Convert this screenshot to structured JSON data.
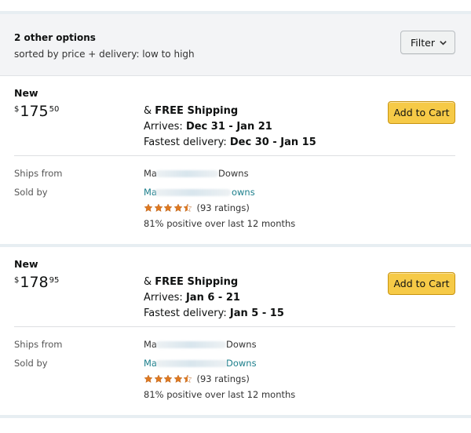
{
  "header": {
    "count_label": "2 other options",
    "sort_label": "sorted by price + delivery: low to high",
    "filter_label": "Filter"
  },
  "offers": [
    {
      "condition": "New",
      "price_symbol": "$",
      "price_whole": "175",
      "price_fraction": "50",
      "shipping_prefix": "& ",
      "shipping": "FREE Shipping",
      "arrives_label": "Arrives: ",
      "arrives": "Dec 31 - Jan 21",
      "fastest_label": "Fastest delivery: ",
      "fastest": "Dec 30 - Jan 15",
      "add_to_cart": "Add to Cart",
      "ships_from_label": "Ships from",
      "ships_from_visible_start": "Ma",
      "ships_from_visible_end": "Downs",
      "sold_by_label": "Sold by",
      "sold_by_visible_start": "Ma",
      "sold_by_visible_end": "owns",
      "rating_count": "(93 ratings)",
      "rating_value": 4.5,
      "positive": "81% positive over last 12 months"
    },
    {
      "condition": "New",
      "price_symbol": "$",
      "price_whole": "178",
      "price_fraction": "95",
      "shipping_prefix": "& ",
      "shipping": "FREE Shipping",
      "arrives_label": "Arrives: ",
      "arrives": "Jan 6 - 21",
      "fastest_label": "Fastest delivery: ",
      "fastest": "Jan 5 - 15",
      "add_to_cart": "Add to Cart",
      "ships_from_label": "Ships from",
      "ships_from_visible_start": "Ma",
      "ships_from_visible_end": "Downs",
      "sold_by_label": "Sold by",
      "sold_by_visible_start": "Ma",
      "sold_by_visible_end": "Downs",
      "rating_count": "(93 ratings)",
      "rating_value": 4.5,
      "positive": "81% positive over last 12 months"
    }
  ],
  "colors": {
    "button_yellow": "#f6ca47",
    "link_teal": "#1b7e8b",
    "star_orange": "#de7921"
  },
  "icons": {
    "filter_chevron": "chevron-down-icon",
    "star_full": "star-full-icon",
    "star_half": "star-half-icon"
  }
}
